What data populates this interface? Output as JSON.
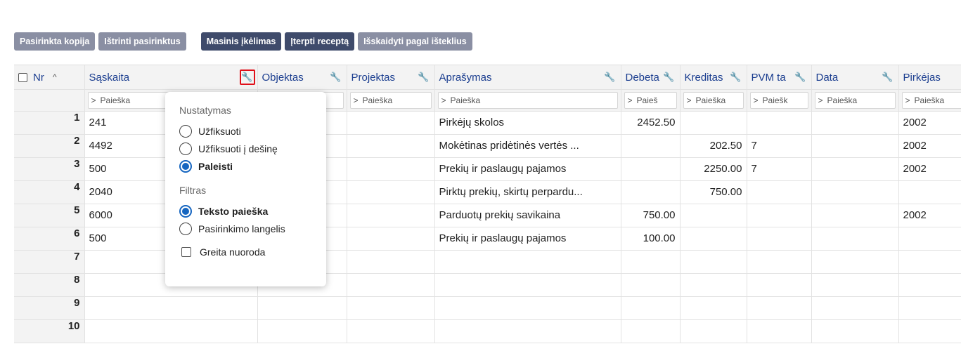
{
  "toolbar": {
    "buttons": [
      {
        "label": "Pasirinkta kopija",
        "style": "grey"
      },
      {
        "label": "Ištrinti pasirinktus",
        "style": "grey"
      },
      {
        "label": "Masinis įkėlimas",
        "style": "dark"
      },
      {
        "label": "Įterpti receptą",
        "style": "dark"
      },
      {
        "label": "Išskaidyti pagal išteklius",
        "style": "grey"
      }
    ]
  },
  "grid": {
    "columns": [
      "Nr",
      "Sąskaita",
      "Objektas",
      "Projektas",
      "Aprašymas",
      "Debetas",
      "Kreditas",
      "PVM ta",
      "Data",
      "Pirkėjas"
    ],
    "column_headers_shown": [
      "Nr",
      "Sąskaita",
      "Objektas",
      "Projektas",
      "Aprašymas",
      "Debeta",
      "Kreditas",
      "PVM ta",
      "Data",
      "Pirkėjas"
    ],
    "sort_indicator": "^",
    "filter_placeholder": "Paieška",
    "filter_shown": [
      "",
      "Paieška",
      "",
      "Paieška",
      "Paieška",
      "Paieš",
      "Paieška",
      "Paiešk",
      "Paieška",
      "Paieška"
    ],
    "rows": [
      {
        "nr": "1",
        "saskaita": "241",
        "objektas": "",
        "projektas": "",
        "aprasymas": "Pirkėjų skolos",
        "debetas": "2452.50",
        "kreditas": "",
        "pvm": "",
        "data": "",
        "pirkejas": "2002"
      },
      {
        "nr": "2",
        "saskaita": "4492",
        "objektas": "",
        "projektas": "",
        "aprasymas": "Mokėtinas pridėtinės vertės ...",
        "debetas": "",
        "kreditas": "202.50",
        "pvm": "7",
        "data": "",
        "pirkejas": "2002"
      },
      {
        "nr": "3",
        "saskaita": "500",
        "objektas": "",
        "projektas": "",
        "aprasymas": "Prekių ir paslaugų pajamos",
        "debetas": "",
        "kreditas": "2250.00",
        "pvm": "7",
        "data": "",
        "pirkejas": "2002"
      },
      {
        "nr": "4",
        "saskaita": "2040",
        "objektas": "",
        "projektas": "",
        "aprasymas": "Pirktų prekių, skirtų perpardu...",
        "debetas": "",
        "kreditas": "750.00",
        "pvm": "",
        "data": "",
        "pirkejas": ""
      },
      {
        "nr": "5",
        "saskaita": "6000",
        "objektas": "",
        "projektas": "",
        "aprasymas": "Parduotų prekių savikaina",
        "debetas": "750.00",
        "kreditas": "",
        "pvm": "",
        "data": "",
        "pirkejas": "2002"
      },
      {
        "nr": "6",
        "saskaita": "500",
        "objektas": "",
        "projektas": "",
        "aprasymas": "Prekių ir paslaugų pajamos",
        "debetas": "100.00",
        "kreditas": "",
        "pvm": "",
        "data": "",
        "pirkejas": ""
      },
      {
        "nr": "7",
        "saskaita": "",
        "objektas": "",
        "projektas": "",
        "aprasymas": "",
        "debetas": "",
        "kreditas": "",
        "pvm": "",
        "data": "",
        "pirkejas": ""
      },
      {
        "nr": "8",
        "saskaita": "",
        "objektas": "",
        "projektas": "",
        "aprasymas": "",
        "debetas": "",
        "kreditas": "",
        "pvm": "",
        "data": "",
        "pirkejas": ""
      },
      {
        "nr": "9",
        "saskaita": "",
        "objektas": "",
        "projektas": "",
        "aprasymas": "",
        "debetas": "",
        "kreditas": "",
        "pvm": "",
        "data": "",
        "pirkejas": ""
      },
      {
        "nr": "10",
        "saskaita": "",
        "objektas": "",
        "projektas": "",
        "aprasymas": "",
        "debetas": "",
        "kreditas": "",
        "pvm": "",
        "data": "",
        "pirkejas": ""
      }
    ]
  },
  "popover": {
    "section1_title": "Nustatymas",
    "section1_options": [
      {
        "label": "Užfiksuoti",
        "selected": false
      },
      {
        "label": "Užfiksuoti į dešinę",
        "selected": false
      },
      {
        "label": "Paleisti",
        "selected": true
      }
    ],
    "section2_title": "Filtras",
    "section2_options": [
      {
        "label": "Teksto paieška",
        "selected": true
      },
      {
        "label": "Pasirinkimo langelis",
        "selected": false
      }
    ],
    "checkbox_label": "Greita nuoroda",
    "checkbox_checked": false
  },
  "colors": {
    "accent": "#1565c0",
    "header_text": "#1a3d8f",
    "highlight_border": "#e0101a",
    "button_grey": "#8a8fa3",
    "button_dark": "#3f4b6b"
  },
  "icons": {
    "column_settings": "wrench-icon",
    "filter_expand": "chevron-right-icon",
    "sort": "chevron-up-icon"
  }
}
